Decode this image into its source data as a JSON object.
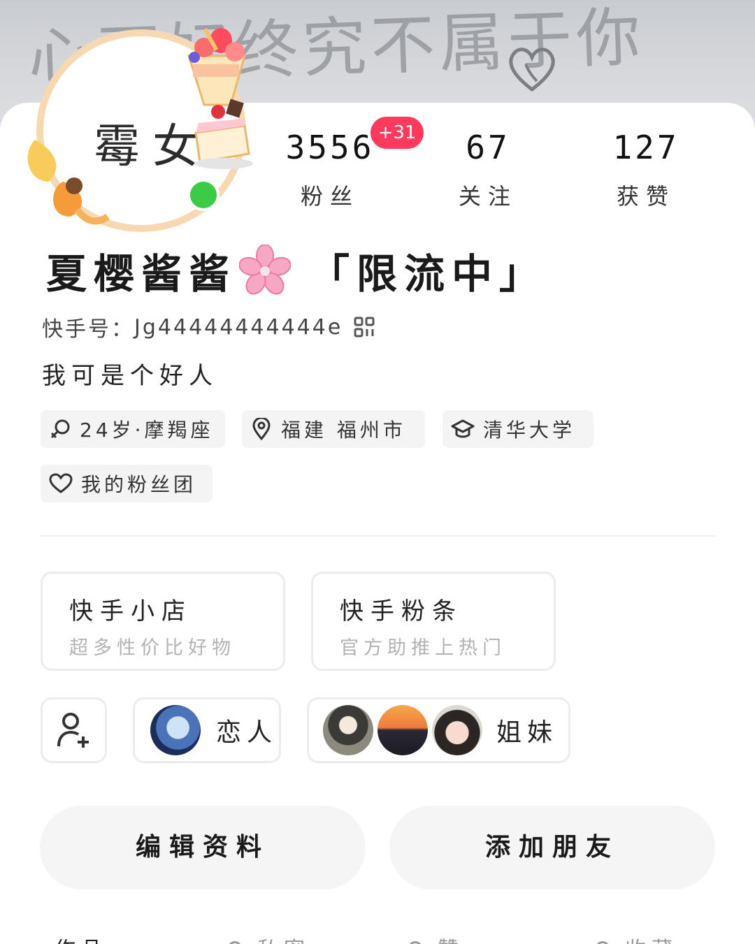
{
  "banner": {
    "handwriting": "心再好终究不属于你"
  },
  "avatar": {
    "text": "霉女"
  },
  "stats": [
    {
      "value": "3556",
      "label": "粉丝",
      "badge": "+31"
    },
    {
      "value": "67",
      "label": "关注"
    },
    {
      "value": "127",
      "label": "获赞"
    }
  ],
  "profile": {
    "name": "夏樱酱酱",
    "name_suffix": "「限流中」",
    "id_label": "快手号：",
    "id_value": "Jg44444444444e",
    "bio": "我可是个好人"
  },
  "tags": [
    {
      "icon": "gender-female-icon",
      "label": "24岁·摩羯座"
    },
    {
      "icon": "location-pin-icon",
      "label": "福建 福州市"
    },
    {
      "icon": "graduation-cap-icon",
      "label": "清华大学"
    },
    {
      "icon": "heart-icon",
      "label": "我的粉丝团"
    }
  ],
  "services": [
    {
      "title": "快手小店",
      "subtitle": "超多性价比好物"
    },
    {
      "title": "快手粉条",
      "subtitle": "官方助推上热门"
    }
  ],
  "relations": [
    {
      "label": "恋人"
    },
    {
      "label": "姐妹"
    }
  ],
  "actions": {
    "edit": "编辑资料",
    "add_friend": "添加朋友"
  },
  "bottom_tabs": [
    "作品",
    "私密",
    "赞",
    "收藏"
  ],
  "colors": {
    "badge": "#fd3a5b",
    "online": "#3bcb47",
    "avatar_ring": "#f6d8b2"
  }
}
